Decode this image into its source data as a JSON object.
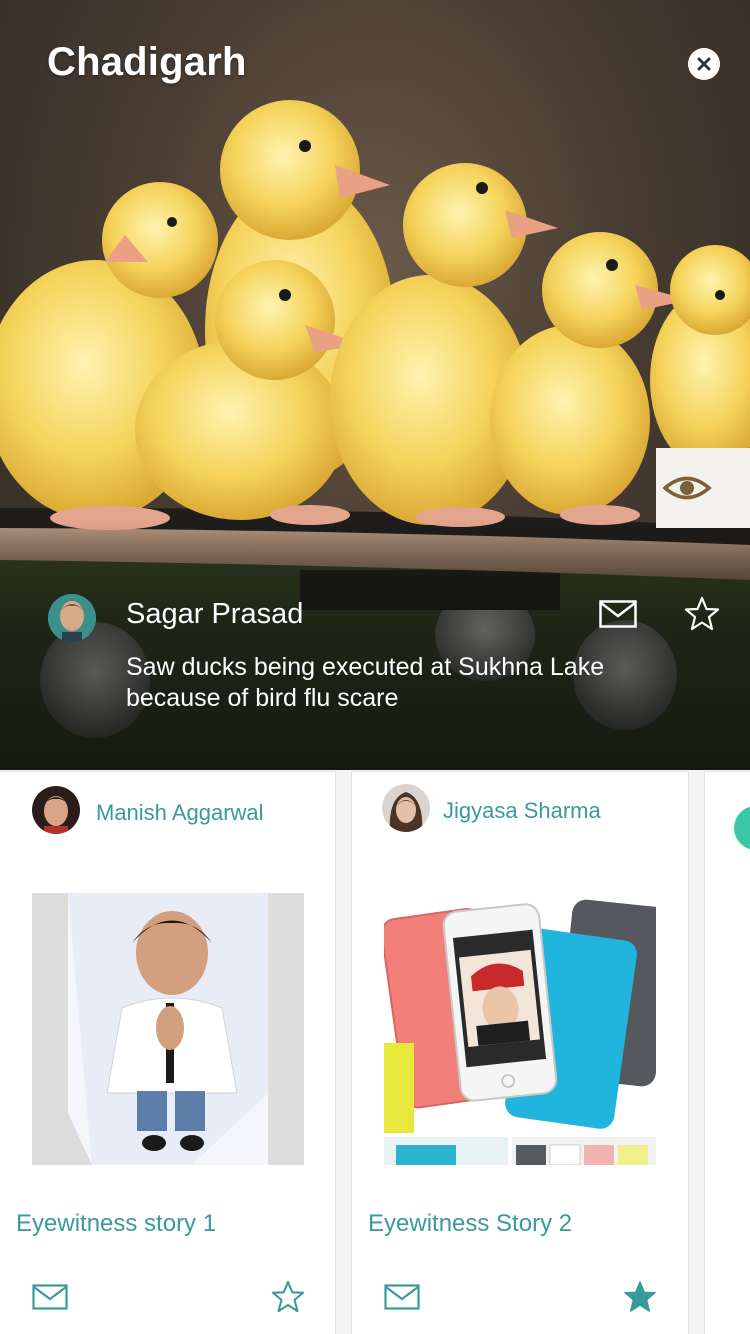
{
  "hero": {
    "title": "Chadigarh",
    "author_name": "Sagar Prasad",
    "text": "Saw ducks being executed at Sukhna Lake because of bird flu scare",
    "close_icon": "close-icon",
    "eye_icon": "eye-icon",
    "mail_icon": "mail-icon",
    "star_icon": "star-outline-icon"
  },
  "cards": [
    {
      "author": "Manish Aggarwal",
      "title": "Eyewitness story 1",
      "starred": false
    },
    {
      "author": "Jigyasa Sharma",
      "title": "Eyewitness Story 2",
      "starred": true
    }
  ],
  "colors": {
    "accent": "#3a9a9a",
    "peek": "#3cc7a7",
    "duckling": "#f5d35a"
  }
}
